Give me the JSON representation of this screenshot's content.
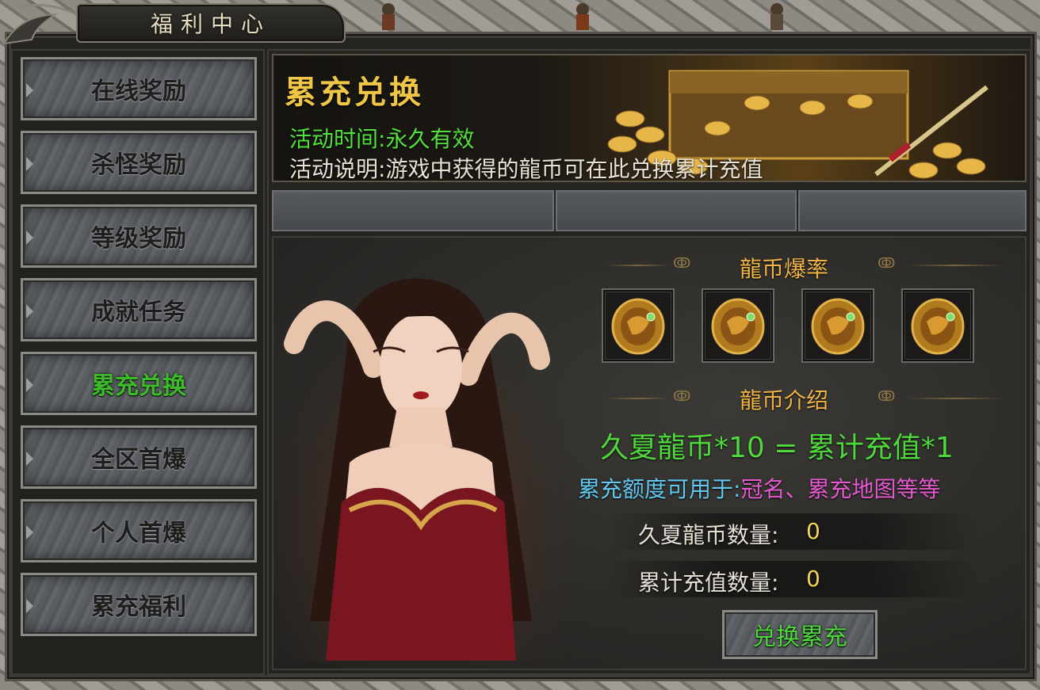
{
  "window": {
    "title": "福利中心"
  },
  "sidebar": {
    "items": [
      {
        "label": "在线奖励",
        "active": false
      },
      {
        "label": "杀怪奖励",
        "active": false
      },
      {
        "label": "等级奖励",
        "active": false
      },
      {
        "label": "成就任务",
        "active": false
      },
      {
        "label": "累充兑换",
        "active": true
      },
      {
        "label": "全区首爆",
        "active": false
      },
      {
        "label": "个人首爆",
        "active": false
      },
      {
        "label": "累充福利",
        "active": false
      }
    ]
  },
  "banner": {
    "title": "累充兑换",
    "time_key": "活动时间:",
    "time_value": "永久有效",
    "desc_key": "活动说明:",
    "desc_value": "游戏中获得的龍币可在此兑换累计充值"
  },
  "panel": {
    "drop_title": "龍币爆率",
    "coins": [
      "dragon-coin-icon",
      "dragon-coin-icon",
      "dragon-coin-icon",
      "dragon-coin-icon"
    ],
    "intro_title": "龍币介绍",
    "formula": "久夏龍币*10 = 累计充值*1",
    "usage_key": "累充额度可用于:",
    "usage_value": "冠名、累充地图等等",
    "coin_count_label": "久夏龍币数量:",
    "coin_count_value": "0",
    "recharge_count_label": "累计充值数量:",
    "recharge_count_value": "0",
    "exchange_button": "兑换累充"
  },
  "colors": {
    "accent_gold": "#f0c646",
    "active_green": "#3dbb2a",
    "usage_blue": "#62c8ef",
    "usage_pink": "#e55ad0"
  }
}
